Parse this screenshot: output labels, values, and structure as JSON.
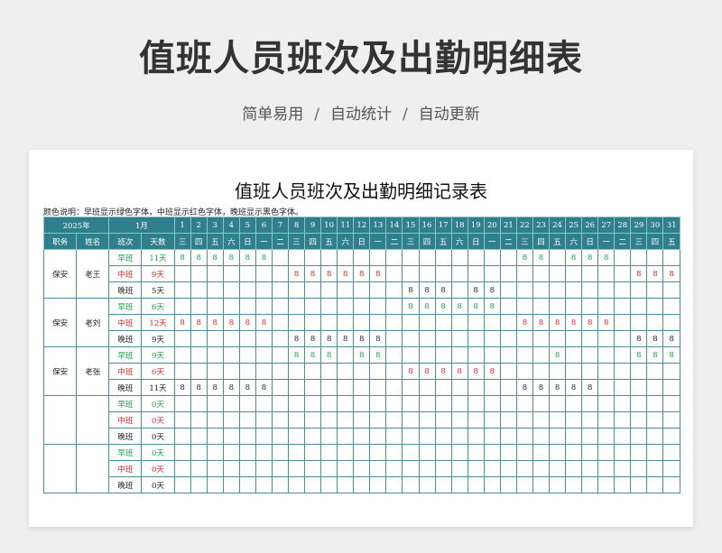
{
  "main_title": "值班人员班次及出勤明细表",
  "subtitle": {
    "a": "简单易用",
    "sep": "/",
    "b": "自动统计",
    "c": "自动更新"
  },
  "sheet": {
    "title": "值班人员班次及出勤明细记录表",
    "note": "颜色说明：早班显示绿色字体，中班显示红色字体，晚班显示黑色字体。",
    "year": "2025年",
    "month": "1月",
    "headers": {
      "role": "职务",
      "name": "姓名",
      "shift": "班次",
      "days": "天数"
    },
    "dates": [
      "1",
      "2",
      "3",
      "4",
      "5",
      "6",
      "7",
      "8",
      "9",
      "10",
      "11",
      "12",
      "13",
      "14",
      "15",
      "16",
      "17",
      "18",
      "19",
      "20",
      "21",
      "22",
      "23",
      "24",
      "25",
      "26",
      "27",
      "28",
      "29",
      "30",
      "31"
    ],
    "weekdays": [
      "三",
      "四",
      "五",
      "六",
      "日",
      "一",
      "二",
      "三",
      "四",
      "五",
      "六",
      "日",
      "一",
      "二",
      "三",
      "四",
      "五",
      "六",
      "日",
      "一",
      "二",
      "三",
      "四",
      "五",
      "六",
      "日",
      "一",
      "二",
      "三",
      "四",
      "五"
    ],
    "shift_colors": {
      "早班": "#1aa14a",
      "中班": "#e02828",
      "晚班": "#222222"
    },
    "groups": [
      {
        "role": "保安",
        "name": "老王",
        "shifts": [
          {
            "shift": "早班",
            "days": "11天",
            "marks": [
              "8",
              "8",
              "8",
              "8",
              "8",
              "8",
              "",
              "",
              "",
              "",
              "",
              "",
              "",
              "",
              "",
              "",
              "",
              "",
              "",
              "",
              "",
              "8",
              "8",
              "",
              "8",
              "8",
              "8",
              "",
              "",
              "",
              ""
            ]
          },
          {
            "shift": "中班",
            "days": "9天",
            "marks": [
              "",
              "",
              "",
              "",
              "",
              "",
              "",
              "8",
              "8",
              "8",
              "8",
              "8",
              "8",
              "",
              "",
              "",
              "",
              "",
              "",
              "",
              "",
              "",
              "",
              "",
              "",
              "",
              "",
              "",
              "8",
              "8",
              "8"
            ]
          },
          {
            "shift": "晚班",
            "days": "5天",
            "marks": [
              "",
              "",
              "",
              "",
              "",
              "",
              "",
              "",
              "",
              "",
              "",
              "",
              "",
              "",
              "8",
              "8",
              "8",
              "",
              "8",
              "8",
              "",
              "",
              "",
              "",
              "",
              "",
              "",
              "",
              "",
              "",
              ""
            ]
          }
        ]
      },
      {
        "role": "保安",
        "name": "老刘",
        "shifts": [
          {
            "shift": "早班",
            "days": "6天",
            "marks": [
              "",
              "",
              "",
              "",
              "",
              "",
              "",
              "",
              "",
              "",
              "",
              "",
              "",
              "",
              "8",
              "8",
              "8",
              "8",
              "8",
              "8",
              "",
              "",
              "",
              "",
              "",
              "",
              "",
              "",
              "",
              "",
              ""
            ]
          },
          {
            "shift": "中班",
            "days": "12天",
            "marks": [
              "8",
              "8",
              "8",
              "8",
              "8",
              "8",
              "",
              "",
              "",
              "",
              "",
              "",
              "",
              "",
              "",
              "",
              "",
              "",
              "",
              "",
              "",
              "8",
              "8",
              "8",
              "8",
              "8",
              "8",
              "",
              "",
              "",
              ""
            ]
          },
          {
            "shift": "晚班",
            "days": "9天",
            "marks": [
              "",
              "",
              "",
              "",
              "",
              "",
              "",
              "8",
              "8",
              "8",
              "8",
              "8",
              "8",
              "",
              "",
              "",
              "",
              "",
              "",
              "",
              "",
              "",
              "",
              "",
              "",
              "",
              "",
              "",
              "8",
              "8",
              "8"
            ]
          }
        ]
      },
      {
        "role": "保安",
        "name": "老张",
        "shifts": [
          {
            "shift": "早班",
            "days": "9天",
            "marks": [
              "",
              "",
              "",
              "",
              "",
              "",
              "",
              "8",
              "8",
              "8",
              "",
              "8",
              "8",
              "",
              "",
              "",
              "",
              "",
              "",
              "",
              "",
              "",
              "",
              "8",
              "",
              "",
              "",
              "",
              "8",
              "8",
              "8"
            ]
          },
          {
            "shift": "中班",
            "days": "6天",
            "marks": [
              "",
              "",
              "",
              "",
              "",
              "",
              "",
              "",
              "",
              "",
              "",
              "",
              "",
              "",
              "8",
              "8",
              "8",
              "8",
              "8",
              "8",
              "",
              "",
              "",
              "",
              "",
              "",
              "",
              "",
              "",
              "",
              ""
            ]
          },
          {
            "shift": "晚班",
            "days": "11天",
            "marks": [
              "8",
              "8",
              "8",
              "8",
              "8",
              "8",
              "",
              "",
              "",
              "",
              "",
              "",
              "",
              "",
              "",
              "",
              "",
              "",
              "",
              "",
              "",
              "8",
              "8",
              "8",
              "8",
              "8",
              "",
              "",
              "",
              "",
              ""
            ]
          }
        ]
      },
      {
        "role": "",
        "name": "",
        "shifts": [
          {
            "shift": "早班",
            "days": "0天",
            "marks": []
          },
          {
            "shift": "中班",
            "days": "0天",
            "marks": []
          },
          {
            "shift": "晚班",
            "days": "0天",
            "marks": []
          }
        ]
      },
      {
        "role": "",
        "name": "",
        "shifts": [
          {
            "shift": "早班",
            "days": "0天",
            "marks": []
          },
          {
            "shift": "中班",
            "days": "0天",
            "marks": []
          },
          {
            "shift": "晚班",
            "days": "0天",
            "marks": []
          }
        ]
      }
    ]
  }
}
